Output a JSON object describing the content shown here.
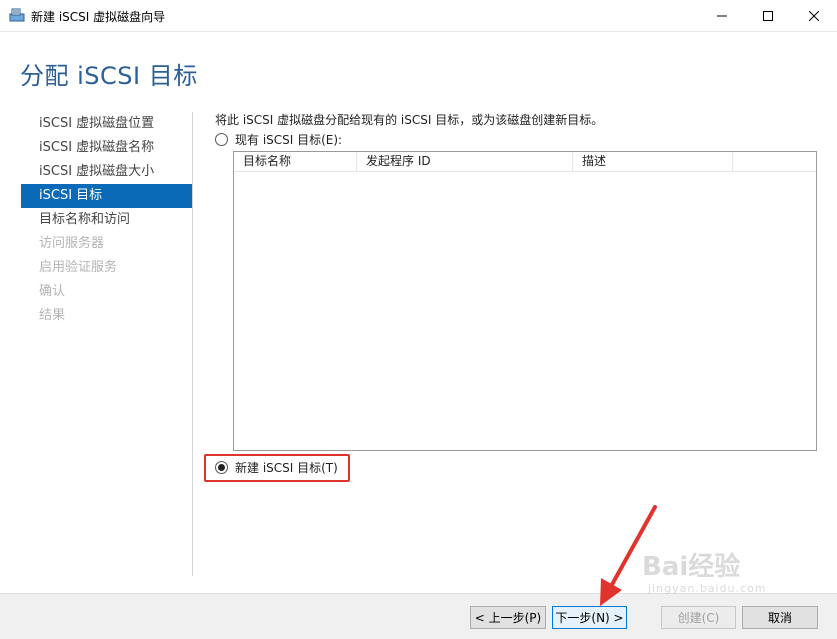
{
  "window": {
    "title": "新建 iSCSI 虚拟磁盘向导",
    "controls": {
      "minimize": "minimize-icon",
      "maximize": "maximize-icon",
      "close": "close-icon"
    }
  },
  "header": {
    "title": "分配 iSCSI 目标"
  },
  "sidebar": {
    "items": [
      {
        "label": "iSCSI 虚拟磁盘位置",
        "state": "done"
      },
      {
        "label": "iSCSI 虚拟磁盘名称",
        "state": "done"
      },
      {
        "label": "iSCSI 虚拟磁盘大小",
        "state": "done"
      },
      {
        "label": "iSCSI 目标",
        "state": "active"
      },
      {
        "label": "目标名称和访问",
        "state": "enabled"
      },
      {
        "label": "访问服务器",
        "state": "disabled"
      },
      {
        "label": "启用验证服务",
        "state": "disabled"
      },
      {
        "label": "确认",
        "state": "disabled"
      },
      {
        "label": "结果",
        "state": "disabled"
      }
    ]
  },
  "main": {
    "intro": "将此 iSCSI 虚拟磁盘分配给现有的 iSCSI 目标，或为该磁盘创建新目标。",
    "existing_option": {
      "label": "现有 iSCSI 目标(E):",
      "checked": false
    },
    "table": {
      "columns": [
        "目标名称",
        "发起程序 ID",
        "描述"
      ],
      "rows": []
    },
    "new_option": {
      "label": "新建 iSCSI 目标(T)",
      "checked": true
    }
  },
  "footer": {
    "prev": "< 上一步(P)",
    "next": "下一步(N) >",
    "create": "创建(C)",
    "cancel": "取消"
  },
  "annotation": {
    "highlight_color": "#e0332c"
  },
  "watermark": {
    "text": "Bai经验",
    "sub": "jingyan.baidu.com"
  }
}
